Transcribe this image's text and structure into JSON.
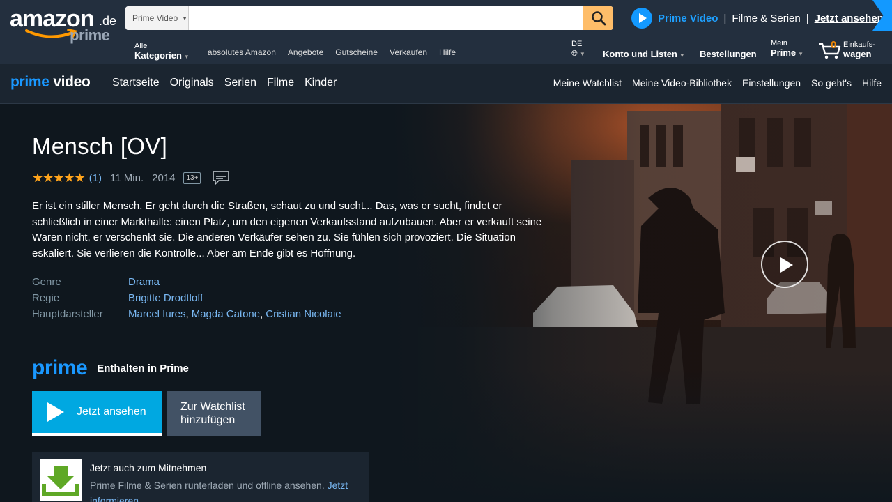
{
  "header": {
    "logo_word": "amazon",
    "logo_tld": ".de",
    "logo_sub": "prime",
    "search": {
      "department": "Prime Video",
      "placeholder": ""
    },
    "promo": {
      "brand": "Prime Video",
      "separator": "|",
      "text": "Filme & Serien",
      "link": "Jetzt ansehen"
    },
    "all_categories_line1": "Alle",
    "all_categories_line2": "Kategorien",
    "nav_items": [
      "absolutes Amazon",
      "Angebote",
      "Gutscheine",
      "Verkaufen",
      "Hilfe"
    ],
    "language": "DE",
    "account": "Konto und Listen",
    "orders": "Bestellungen",
    "mein_line1": "Mein",
    "mein_line2": "Prime",
    "cart_count": "0",
    "cart_line1": "Einkaufs-",
    "cart_line2": "wagen",
    "colors": {
      "bar": "#232f3e",
      "search_button": "#febd69",
      "cart_count": "#f08804"
    }
  },
  "pvnav": {
    "logo_blue": "prime",
    "logo_white": "video",
    "left": [
      "Startseite",
      "Originals",
      "Serien",
      "Filme",
      "Kinder"
    ],
    "right": [
      "Meine Watchlist",
      "Meine Video-Bibliothek",
      "Einstellungen",
      "So geht's",
      "Hilfe"
    ]
  },
  "title": {
    "name": "Mensch [OV]",
    "rating_stars": 5,
    "rating_count": "(1)",
    "duration": "11 Min.",
    "year": "2014",
    "age_rating": "13+",
    "description": "Er ist ein stiller Mensch. Er geht durch die Straßen, schaut zu und sucht... Das, was er sucht, findet er schließlich in einer Markthalle: einen Platz, um den eigenen Verkaufsstand aufzubauen. Aber er verkauft seine Waren nicht, er verschenkt sie. Die anderen Verkäufer sehen zu. Sie fühlen sich provoziert. Die Situation eskaliert. Sie verlieren die Kontrolle... Aber am Ende gibt es Hoffnung.",
    "credits": {
      "genre_label": "Genre",
      "genre": "Drama",
      "director_label": "Regie",
      "director": "Brigitte Drodtloff",
      "cast_label": "Hauptdarsteller",
      "cast": [
        "Marcel Iures",
        "Magda Catone",
        "Cristian Nicolaie"
      ]
    },
    "prime_word": "prime",
    "included": "Enthalten in Prime",
    "watch_button": "Jetzt ansehen",
    "watchlist_line1": "Zur Watchlist",
    "watchlist_line2": "hinzufügen"
  },
  "download_box": {
    "heading": "Jetzt auch zum Mitnehmen",
    "text": "Prime Filme & Serien runterladen und offline ansehen. ",
    "link": "Jetzt informieren"
  },
  "colors": {
    "accent": "#00a8e1",
    "prime_blue": "#1a98ff",
    "link": "#79b8f3",
    "star": "#ffa41c",
    "background": "#0f171e"
  }
}
